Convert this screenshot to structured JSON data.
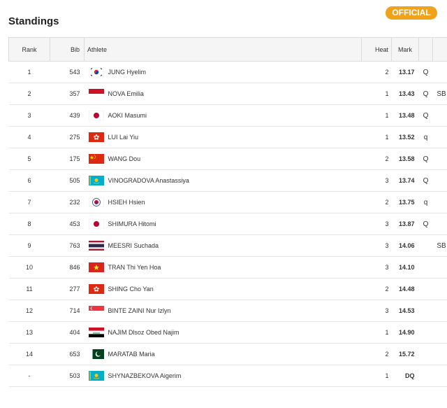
{
  "header": {
    "title": "Standings",
    "badge": "OFFICIAL"
  },
  "columns": {
    "rank": "Rank",
    "bib": "Bib",
    "athlete": "Athlete",
    "heat": "Heat",
    "mark": "Mark"
  },
  "rows": [
    {
      "rank": "1",
      "bib": "543",
      "flag": "KOR",
      "athlete": "JUNG Hyelim",
      "heat": "2",
      "mark": "13.17",
      "q": "Q",
      "sb": ""
    },
    {
      "rank": "2",
      "bib": "357",
      "flag": "INA",
      "athlete": "NOVA Emilia",
      "heat": "1",
      "mark": "13.43",
      "q": "Q",
      "sb": "SB"
    },
    {
      "rank": "3",
      "bib": "439",
      "flag": "JPN",
      "athlete": "AOKI Masumi",
      "heat": "1",
      "mark": "13.48",
      "q": "Q",
      "sb": ""
    },
    {
      "rank": "4",
      "bib": "275",
      "flag": "HKG",
      "athlete": "LUI Lai Yiu",
      "heat": "1",
      "mark": "13.52",
      "q": "q",
      "sb": ""
    },
    {
      "rank": "5",
      "bib": "175",
      "flag": "CHN",
      "athlete": "WANG Dou",
      "heat": "2",
      "mark": "13.58",
      "q": "Q",
      "sb": ""
    },
    {
      "rank": "6",
      "bib": "505",
      "flag": "KAZ",
      "athlete": "VINOGRADOVA Anastassiya",
      "heat": "3",
      "mark": "13.74",
      "q": "Q",
      "sb": ""
    },
    {
      "rank": "7",
      "bib": "232",
      "flag": "TPE",
      "athlete": "HSIEH Hsien",
      "heat": "2",
      "mark": "13.75",
      "q": "q",
      "sb": ""
    },
    {
      "rank": "8",
      "bib": "453",
      "flag": "JPN",
      "athlete": "SHIMURA Hitomi",
      "heat": "3",
      "mark": "13.87",
      "q": "Q",
      "sb": ""
    },
    {
      "rank": "9",
      "bib": "763",
      "flag": "THA",
      "athlete": "MEESRI Suchada",
      "heat": "3",
      "mark": "14.06",
      "q": "",
      "sb": "SB"
    },
    {
      "rank": "10",
      "bib": "846",
      "flag": "VIE",
      "athlete": "TRAN Thi Yen Hoa",
      "heat": "3",
      "mark": "14.10",
      "q": "",
      "sb": ""
    },
    {
      "rank": "11",
      "bib": "277",
      "flag": "HKG",
      "athlete": "SHING Cho Yan",
      "heat": "2",
      "mark": "14.48",
      "q": "",
      "sb": ""
    },
    {
      "rank": "12",
      "bib": "714",
      "flag": "SGP",
      "athlete": "BINTE ZAINI Nur Izlyn",
      "heat": "3",
      "mark": "14.53",
      "q": "",
      "sb": ""
    },
    {
      "rank": "13",
      "bib": "404",
      "flag": "IRQ",
      "athlete": "NAJIM Dlsoz Obed Najim",
      "heat": "1",
      "mark": "14.90",
      "q": "",
      "sb": ""
    },
    {
      "rank": "14",
      "bib": "653",
      "flag": "PAK",
      "athlete": "MARATAB Maria",
      "heat": "2",
      "mark": "15.72",
      "q": "",
      "sb": ""
    },
    {
      "rank": "-",
      "bib": "503",
      "flag": "KAZ",
      "athlete": "SHYNAZBEKOVA Aigerim",
      "heat": "1",
      "mark": "DQ",
      "q": "",
      "sb": ""
    }
  ],
  "icons": {
    "expand": "plus-circle-icon"
  },
  "colors": {
    "badge": "#f0a21a",
    "header_bg": "#f5f5f5"
  }
}
